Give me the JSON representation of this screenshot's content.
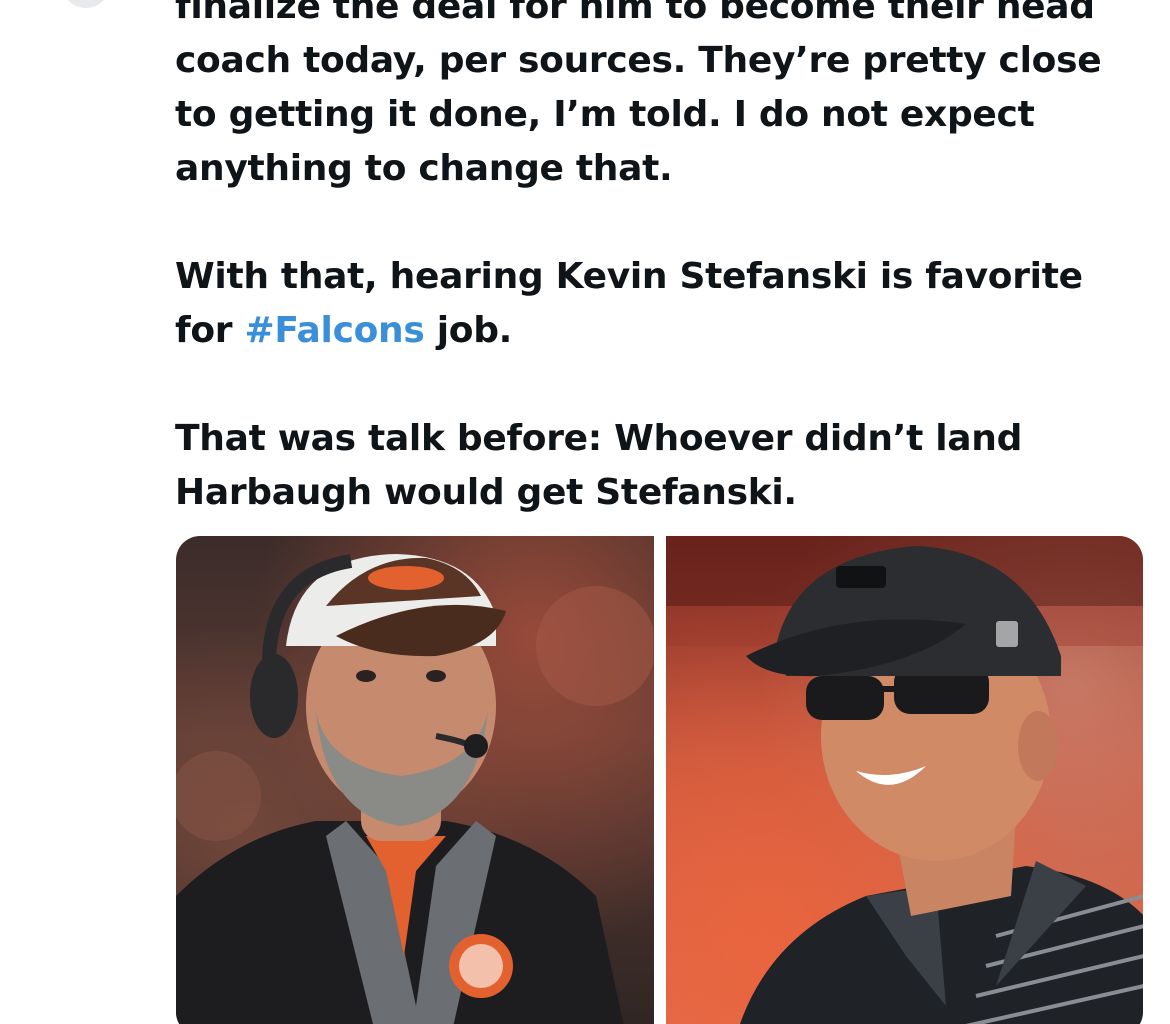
{
  "tweet": {
    "paragraphs": [
      {
        "lines": [
          "finalize the deal for him to become their head",
          "coach today, per sources. They’re pretty close",
          "to getting it done, I’m told. I do not expect",
          "anything to change that."
        ]
      },
      {
        "line1": "With that, hearing Kevin Stefanski is favorite",
        "line2_before": "for ",
        "hashtag": "#Falcons",
        "line2_after": " job."
      },
      {
        "lines": [
          "That was talk before: Whoever didn’t land",
          "Harbaugh would get Stefanski."
        ]
      }
    ],
    "colors": {
      "text": "#0f1419",
      "hashtag": "#3a8fd8"
    }
  },
  "media": {
    "photos": [
      {
        "subject": "coach in brown-orange cap with headset, black jacket with helmet logo, night stadium"
      },
      {
        "subject": "smiling coach in black cap and sunglasses, striped polo, sunny red stadium"
      }
    ]
  }
}
